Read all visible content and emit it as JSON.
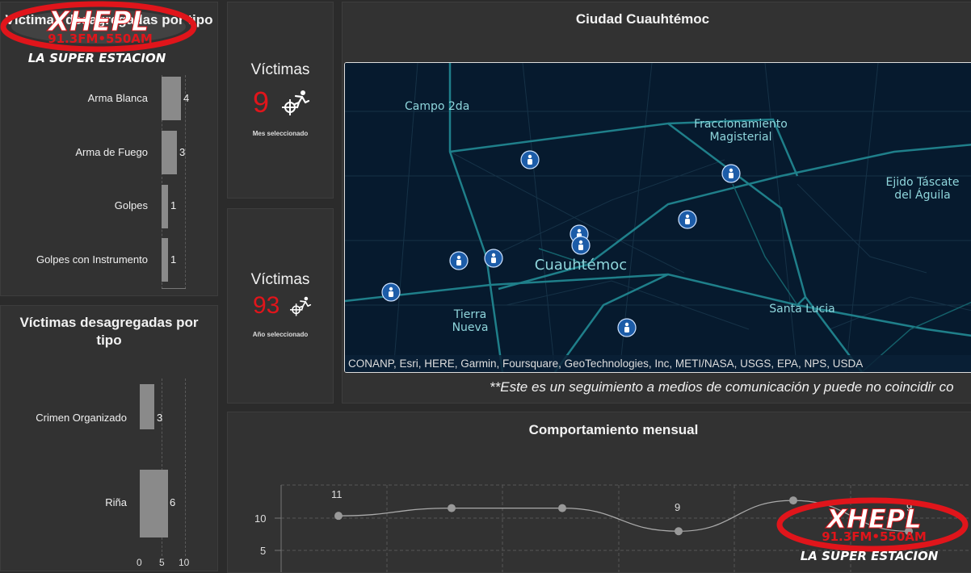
{
  "type_panel_top": {
    "title": "Víctimas desagregadas por tipo",
    "chart_data": {
      "type": "bar",
      "categories": [
        "Arma Blanca",
        "Arma de Fuego",
        "Golpes",
        "Golpes con Instrumento"
      ],
      "values": [
        4,
        3,
        1,
        1
      ]
    }
  },
  "type_panel_bottom": {
    "title": "Víctimas desagregadas por tipo",
    "axis_ticks": [
      "0",
      "5",
      "10"
    ],
    "chart_data": {
      "type": "bar",
      "categories": [
        "Crimen Organizado",
        "Riña"
      ],
      "values": [
        3,
        6
      ],
      "xlim": [
        0,
        10
      ]
    }
  },
  "kpi_month": {
    "title": "Víctimas",
    "value": "9",
    "sub": "Mes seleccionado",
    "icon": "shooting-victim-icon"
  },
  "kpi_year": {
    "title": "Víctimas",
    "value": "93",
    "sub": "Año seleccionado",
    "icon": "shooting-victim-icon"
  },
  "map": {
    "title": "Ciudad Cuauhtémoc",
    "labels": {
      "campo": "Campo 2da",
      "fracc1": "Fraccionamiento",
      "fracc2": "Magisterial",
      "ejido1": "Ejido Táscate",
      "ejido2": "del Águila",
      "city": "Cuauhtémoc",
      "tierra1": "Tierra",
      "tierra2": "Nueva",
      "santa": "Santa Lucia"
    },
    "attribution": "CONANP, Esri, HERE, Garmin, Foursquare, GeoTechnologies, Inc, METI/NASA, USGS, EPA, NPS, USDA",
    "colors": {
      "background": "#061a2e",
      "roads": "#1f7f8a",
      "pins": "#1c5ca8"
    }
  },
  "disclaimer": "**Este es un seguimiento a medios de comunicación y puede no coincidir co",
  "monthly": {
    "title": "Comportamiento mensual",
    "y_ticks": [
      "10",
      "5"
    ],
    "point_labels": [
      "11",
      "9",
      "9"
    ],
    "chart_data": {
      "type": "line",
      "x": [
        1,
        2,
        3,
        4,
        5,
        6
      ],
      "values": [
        11,
        12,
        12,
        9,
        13,
        9
      ],
      "ylim": [
        4,
        15
      ]
    }
  },
  "logo": {
    "top_text": "XHEPL",
    "freq": "91.3FM•550AM",
    "tagline": "LA SUPER ESTACION",
    "color": "#e0151b"
  }
}
